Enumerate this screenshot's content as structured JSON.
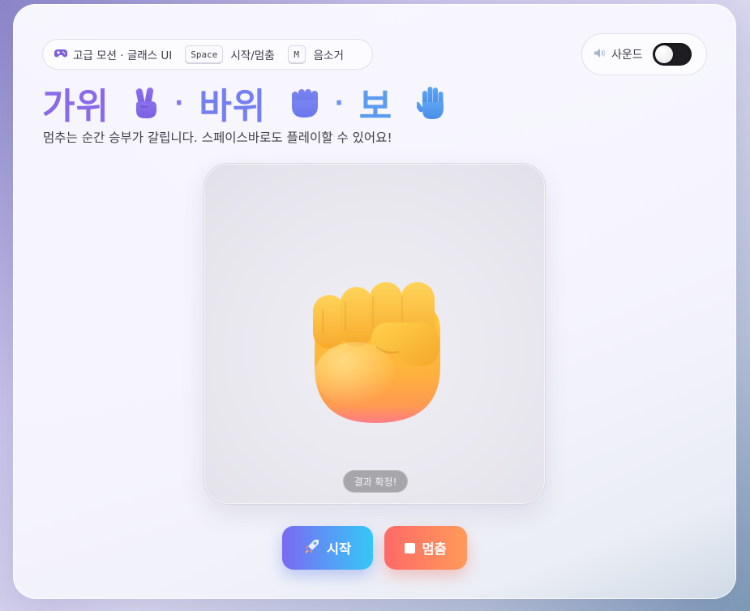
{
  "header": {
    "mode_label": "고급 모션 · 글래스 UI",
    "key_space": "Space",
    "key_space_action": "시작/멈춤",
    "key_m": "M",
    "key_m_action": "음소거"
  },
  "sound": {
    "label": "사운드",
    "enabled": false
  },
  "title": {
    "scissors": "가위",
    "rock": "바위",
    "paper": "보",
    "separator": "·"
  },
  "subtitle": "멈추는 순간 승부가 갈립니다. 스페이스바로도 플레이할 수 있어요!",
  "stage": {
    "current_hand": "fist-emoji",
    "status": "결과 확정!"
  },
  "buttons": {
    "start_label": "시작",
    "stop_label": "멈춤"
  },
  "icons": {
    "header": "gamepad-icon",
    "sound": "speaker-icon",
    "start": "rocket-icon",
    "stop": "stop-square-icon"
  },
  "colors": {
    "title_gradient_start": "#8a6ae8",
    "title_gradient_end": "#5c9bf0",
    "start_gradient": [
      "#7a6af2",
      "#35c8f8"
    ],
    "stop_gradient": [
      "#ff6a66",
      "#ff9a5a"
    ]
  }
}
